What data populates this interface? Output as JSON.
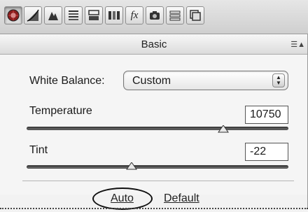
{
  "toolbar": {
    "buttons": [
      {
        "name": "basic-tab-icon"
      },
      {
        "name": "tone-curve-icon"
      },
      {
        "name": "detail-icon"
      },
      {
        "name": "hsl-grayscale-icon"
      },
      {
        "name": "split-toning-icon"
      },
      {
        "name": "lens-corrections-icon"
      },
      {
        "name": "effects-icon",
        "glyph": "fx"
      },
      {
        "name": "camera-calibration-icon"
      },
      {
        "name": "presets-icon"
      },
      {
        "name": "snapshots-icon"
      }
    ]
  },
  "header": {
    "title": "Basic",
    "menu_glyph": "☰▲"
  },
  "white_balance": {
    "label": "White Balance:",
    "value": "Custom",
    "stepper": "▲▼"
  },
  "temperature": {
    "label": "Temperature",
    "value": "10750",
    "position": 0.75
  },
  "tint": {
    "label": "Tint",
    "value": "-22",
    "position": 0.4
  },
  "footer": {
    "auto_label": "Auto",
    "default_label": "Default"
  },
  "colors": {
    "track": "#444444",
    "circle_mark": "#111111"
  }
}
